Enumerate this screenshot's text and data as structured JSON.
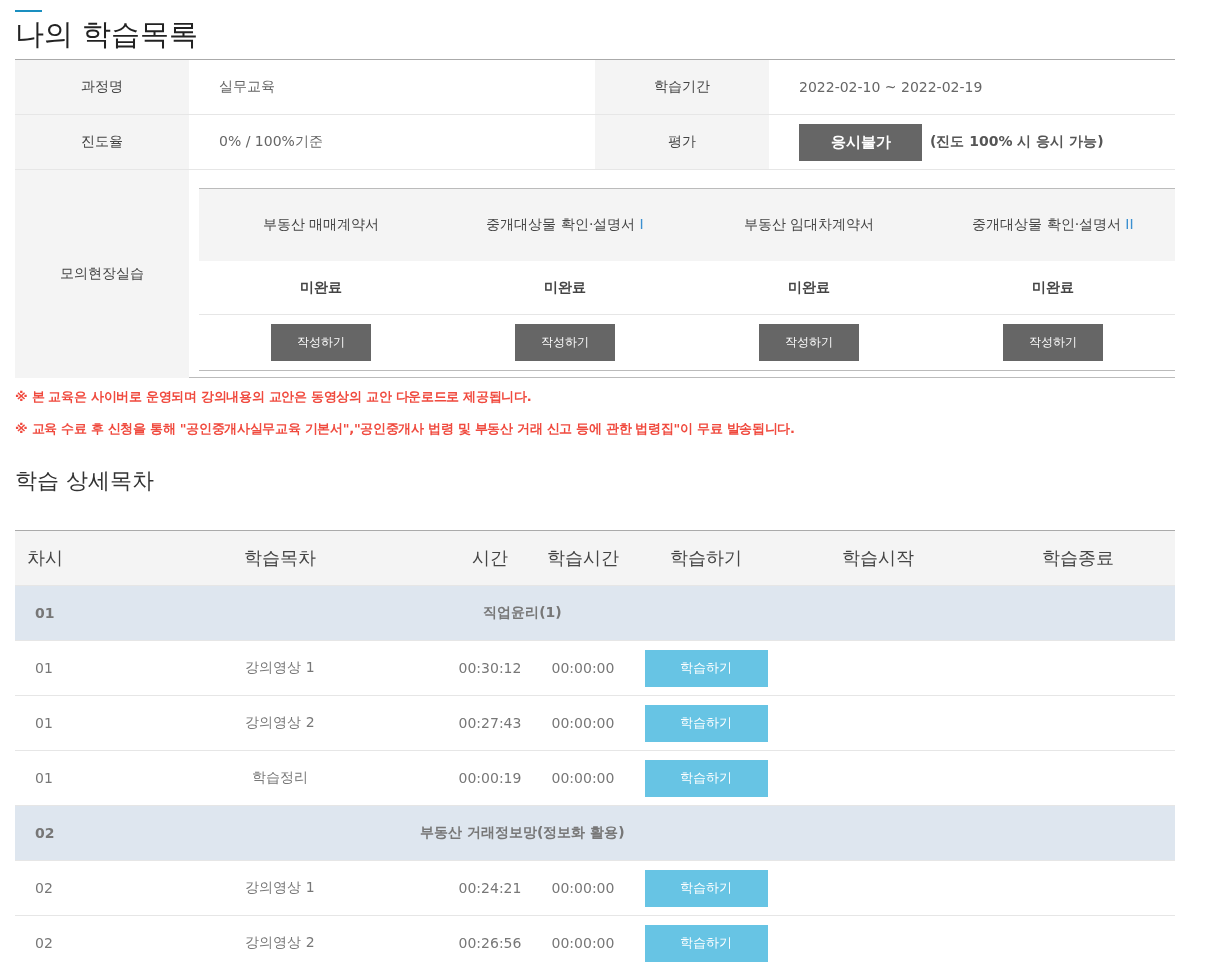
{
  "page_title": "나의 학습목록",
  "course_info": {
    "rows": [
      {
        "cells": [
          {
            "label": "과정명",
            "value": "실무교육"
          },
          {
            "label": "학습기간",
            "value": "2022-02-10 ~ 2022-02-19"
          }
        ]
      },
      {
        "cells": [
          {
            "label": "진도율",
            "value": "0% / 100%기준"
          },
          {
            "label": "평가",
            "button": "응시불가",
            "note": "(진도 100% 시 응시 가능)"
          }
        ]
      }
    ]
  },
  "practice": {
    "label": "모의현장실습",
    "items": [
      {
        "title": "부동산 매매계약서",
        "status": "미완료",
        "button": "작성하기"
      },
      {
        "title": "중개대상물 확인·설명서",
        "mark": "I",
        "status": "미완료",
        "button": "작성하기"
      },
      {
        "title": "부동산 임대차계약서",
        "status": "미완료",
        "button": "작성하기"
      },
      {
        "title": "중개대상물 확인·설명서",
        "mark": "II",
        "status": "미완료",
        "button": "작성하기"
      }
    ]
  },
  "notices": [
    "※ 본 교육은 사이버로 운영되며 강의내용의 교안은 동영상의 교안 다운로드로 제공됩니다.",
    "※ 교육 수료 후 신청을 통해 \"공인중개사실무교육 기본서\",\"공인중개사 법령 및 부동산 거래 신고 등에 관한 법령집\"이 무료 발송됩니다."
  ],
  "section_title": "학습 상세목차",
  "table": {
    "columns": [
      "차시",
      "학습목차",
      "시간",
      "학습시간",
      "학습하기",
      "학습시작",
      "학습종료"
    ],
    "rows": [
      {
        "kind": "section",
        "session": "01",
        "title": "직업윤리(1)"
      },
      {
        "kind": "lesson",
        "session": "01",
        "title": "강의영상 1",
        "time": "00:30:12",
        "study_time": "00:00:00",
        "button": "학습하기"
      },
      {
        "kind": "lesson",
        "session": "01",
        "title": "강의영상 2",
        "time": "00:27:43",
        "study_time": "00:00:00",
        "button": "학습하기"
      },
      {
        "kind": "lesson",
        "session": "01",
        "title": "학습정리",
        "time": "00:00:19",
        "study_time": "00:00:00",
        "button": "학습하기"
      },
      {
        "kind": "section",
        "session": "02",
        "title": "부동산 거래정보망(정보화 활용)"
      },
      {
        "kind": "lesson",
        "session": "02",
        "title": "강의영상 1",
        "time": "00:24:21",
        "study_time": "00:00:00",
        "button": "학습하기"
      },
      {
        "kind": "lesson",
        "session": "02",
        "title": "강의영상 2",
        "time": "00:26:56",
        "study_time": "00:00:00",
        "button": "학습하기"
      }
    ]
  }
}
